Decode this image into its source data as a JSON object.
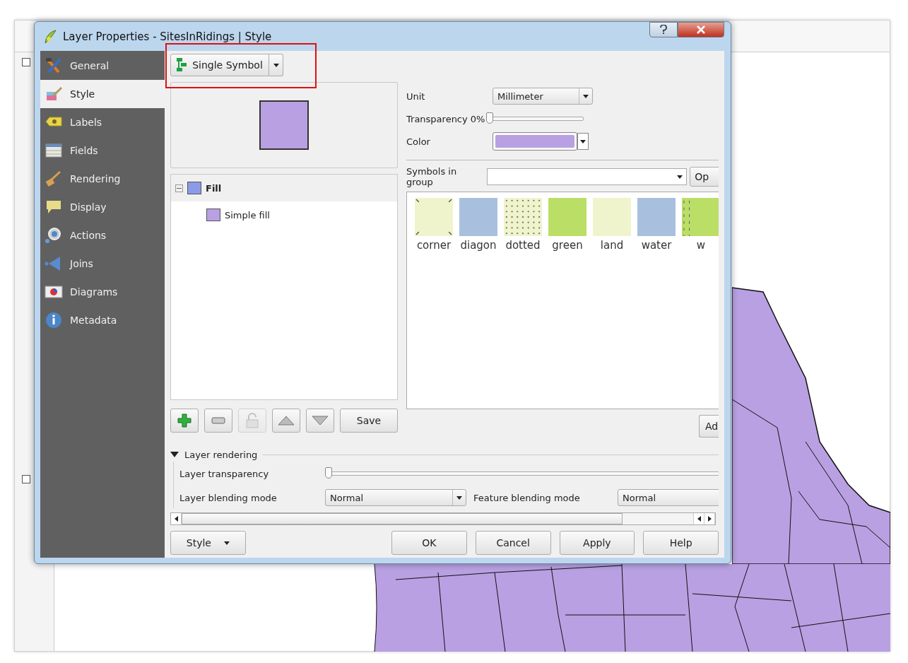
{
  "window": {
    "title": "Layer Properties - SitesInRidings | Style"
  },
  "sidebar": {
    "items": [
      {
        "label": "General",
        "selected": false
      },
      {
        "label": "Style",
        "selected": true
      },
      {
        "label": "Labels",
        "selected": false
      },
      {
        "label": "Fields",
        "selected": false
      },
      {
        "label": "Rendering",
        "selected": false
      },
      {
        "label": "Display",
        "selected": false
      },
      {
        "label": "Actions",
        "selected": false
      },
      {
        "label": "Joins",
        "selected": false
      },
      {
        "label": "Diagrams",
        "selected": false
      },
      {
        "label": "Metadata",
        "selected": false
      }
    ]
  },
  "renderer_button": {
    "label": "Single Symbol"
  },
  "preview": {
    "color": "#b9a0e2"
  },
  "symbol_tree": [
    {
      "label": "Fill",
      "color": "#8c9be8",
      "expanded": true,
      "selected": true,
      "children": [
        {
          "label": "Simple fill",
          "color": "#b9a0e2",
          "selected": false
        }
      ]
    }
  ],
  "layer_buttons": [
    {
      "kind": "add",
      "disabled": false
    },
    {
      "kind": "remove",
      "disabled": false
    },
    {
      "kind": "lock",
      "disabled": true
    },
    {
      "kind": "up",
      "disabled": false
    },
    {
      "kind": "down",
      "disabled": false
    },
    {
      "kind": "text",
      "label": "Save",
      "disabled": false
    }
  ],
  "symbol_settings": {
    "unit": {
      "label": "Unit",
      "value": "Millimeter"
    },
    "transparency": {
      "label": "Transparency 0%",
      "level": 0
    },
    "color": {
      "label": "Color",
      "color": "#b9a0e2"
    }
  },
  "symbols_in_group": {
    "label": "Symbols in group",
    "button": "Op"
  },
  "symbols": [
    {
      "name": "corner",
      "kind": "corners",
      "color": "#f0f4cc"
    },
    {
      "name": "diagon",
      "kind": "solid",
      "color": "#a8c0de"
    },
    {
      "name": "dotted",
      "kind": "dotted",
      "color": "#f0f4cc"
    },
    {
      "name": "green",
      "kind": "solid",
      "color": "#bade66"
    },
    {
      "name": "land",
      "kind": "solid",
      "color": "#f0f4cc"
    },
    {
      "name": "water",
      "kind": "solid",
      "color": "#a8c0de"
    },
    {
      "name": "w",
      "kind": "dashes",
      "color": "#bade66"
    }
  ],
  "add_button": "Ad",
  "layer_rendering": {
    "title": "Layer rendering",
    "expanded": true,
    "transparency": {
      "label": "Layer transparency",
      "level": 0
    },
    "blending": {
      "label": "Layer blending mode",
      "value": "Normal"
    },
    "feature_blending": {
      "label": "Feature blending mode",
      "value": "Normal"
    }
  },
  "footer": {
    "style_button": "Style",
    "buttons": [
      "OK",
      "Cancel",
      "Apply",
      "Help"
    ]
  }
}
